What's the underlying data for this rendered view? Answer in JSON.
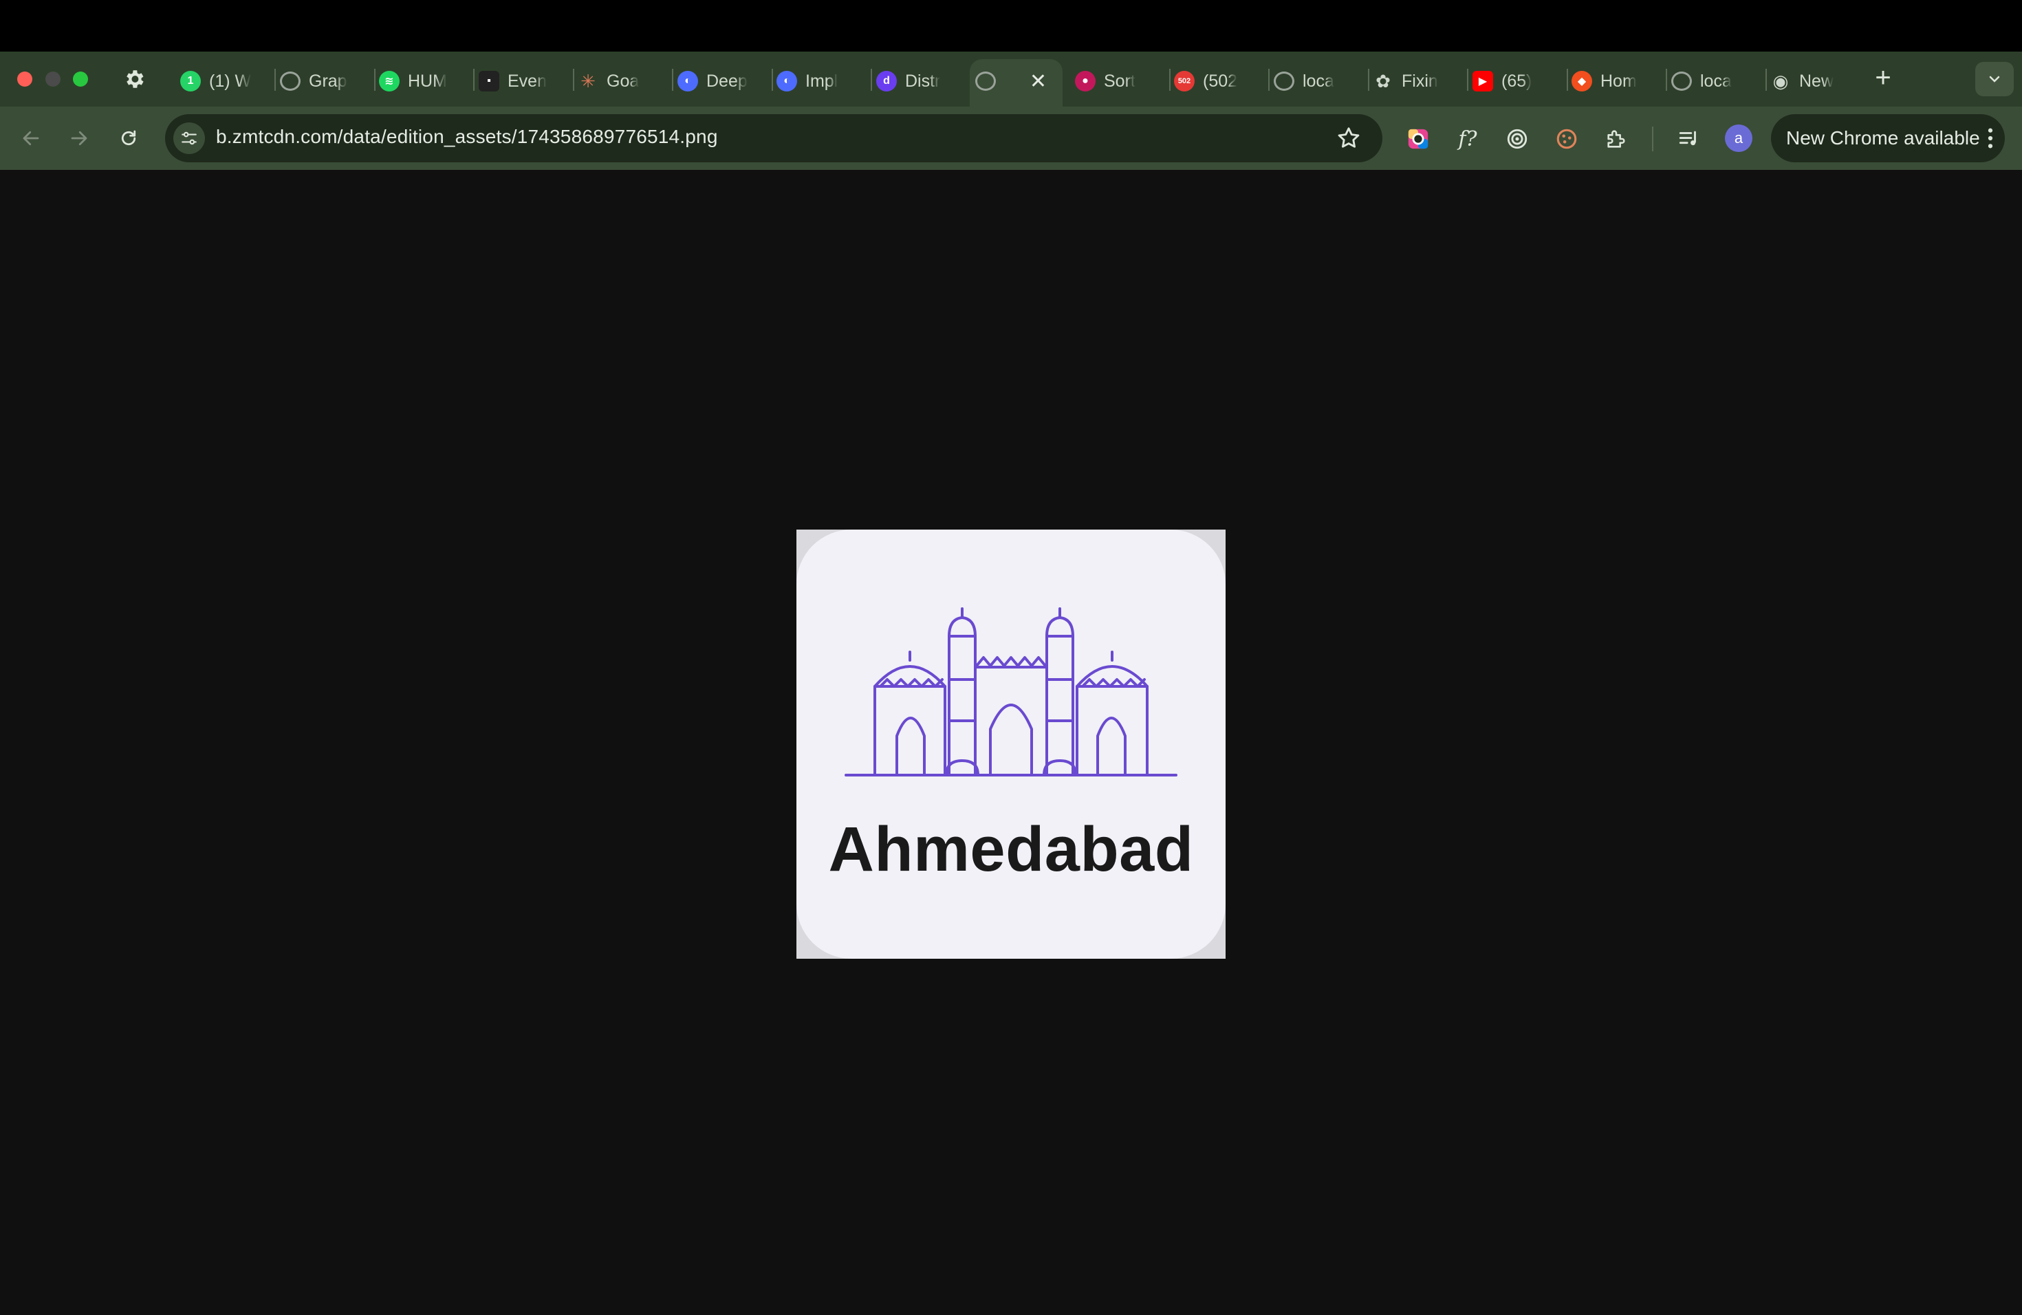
{
  "browser": {
    "tabs": [
      {
        "title": "(1) W",
        "icon": "whatsapp-icon",
        "color": "#25d366"
      },
      {
        "title": "Grap",
        "icon": "globe-icon",
        "color": "#9aa39a"
      },
      {
        "title": "HUM",
        "icon": "spotify-icon",
        "color": "#1ed760"
      },
      {
        "title": "Even",
        "icon": "luma-icon",
        "color": "#222222"
      },
      {
        "title": "Goa",
        "icon": "claude-icon",
        "color": "#d97757"
      },
      {
        "title": "Deep",
        "icon": "deepseek-icon",
        "color": "#4d6bfe"
      },
      {
        "title": "Impl",
        "icon": "deepseek-icon",
        "color": "#4d6bfe"
      },
      {
        "title": "Distr",
        "icon": "district-icon",
        "color": "#6a3df0"
      },
      {
        "title": "",
        "icon": "globe-icon",
        "color": "#9aa39a",
        "active": true
      },
      {
        "title": "Sort",
        "icon": "location-pin-icon",
        "color": "#c2185b"
      },
      {
        "title": "(502",
        "icon": "mail-badge-icon",
        "color": "#e53935"
      },
      {
        "title": "loca",
        "icon": "globe-icon",
        "color": "#9aa39a"
      },
      {
        "title": "Fixin",
        "icon": "openai-icon",
        "color": "#cfd8cc"
      },
      {
        "title": "(65)",
        "icon": "youtube-icon",
        "color": "#ff0000"
      },
      {
        "title": "Hom",
        "icon": "figma-icon",
        "color": "#f24e1e"
      },
      {
        "title": "loca",
        "icon": "globe-icon",
        "color": "#9aa39a"
      },
      {
        "title": "New",
        "icon": "chrome-icon",
        "color": "#cfd8cc"
      }
    ],
    "url": "b.zmtcdn.com/data/edition_assets/174358689776514.png",
    "profile_initial": "a",
    "update_label": "New Chrome available"
  },
  "image": {
    "city_name": "Ahmedabad",
    "line_color": "#6a4ad0",
    "card_color": "#f1f1f7"
  }
}
